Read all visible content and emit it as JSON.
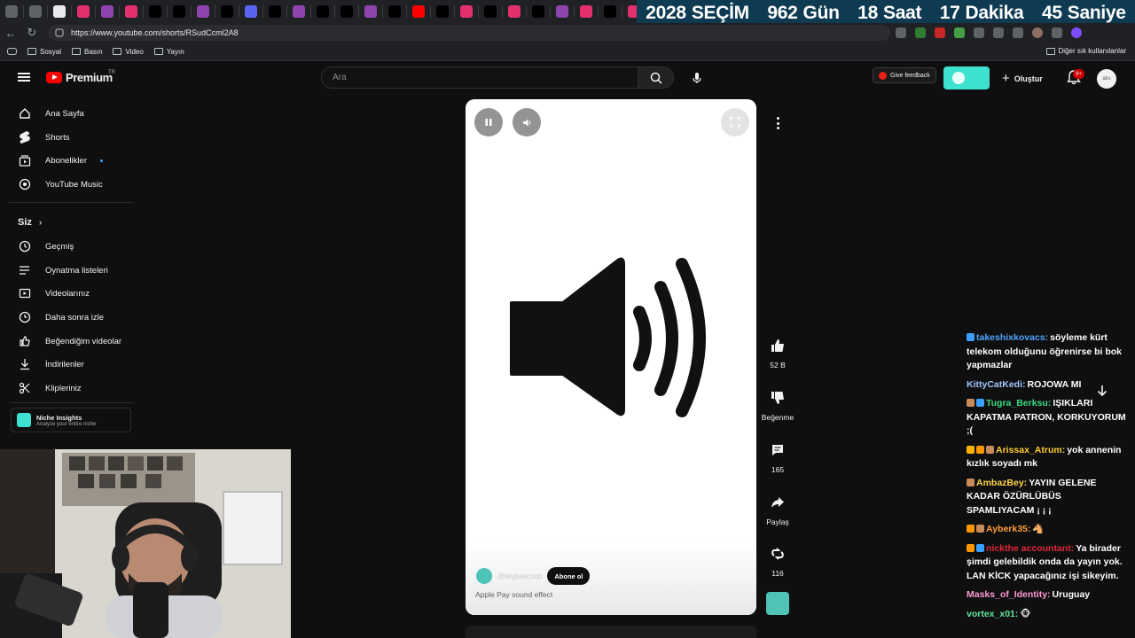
{
  "browser": {
    "url": "https://www.youtube.com/shorts/RSudCcml2A8",
    "bookmarks": [
      "Sosyal",
      "Basın",
      "Video",
      "Yayın"
    ],
    "other_bookmarks": "Diğer sık kullanılanlar"
  },
  "countdown": {
    "year": "2028",
    "label": "SEÇİM",
    "days_value": "962",
    "days_unit": "Gün",
    "hours_value": "18",
    "hours_unit": "Saat",
    "minutes_value": "17",
    "minutes_unit": "Dakika",
    "seconds_value": "45",
    "seconds_unit": "Saniye"
  },
  "header": {
    "logo_text": "Premium",
    "logo_region": "TR",
    "search_placeholder": "Ara",
    "feedback": "Give feedback",
    "create": "Oluştur",
    "notif_count": "9+",
    "avatar_text": "alıs"
  },
  "sidebar": {
    "items": [
      {
        "label": "Ana Sayfa",
        "icon": "home-icon"
      },
      {
        "label": "Shorts",
        "icon": "shorts-icon"
      },
      {
        "label": "Abonelikler",
        "icon": "subscriptions-icon"
      },
      {
        "label": "YouTube Music",
        "icon": "music-icon"
      }
    ],
    "you_heading": "Siz",
    "you_items": [
      {
        "label": "Geçmiş",
        "icon": "history-icon"
      },
      {
        "label": "Oynatma listeleri",
        "icon": "playlist-icon"
      },
      {
        "label": "Videolarınız",
        "icon": "your-videos-icon"
      },
      {
        "label": "Daha sonra izle",
        "icon": "watch-later-icon"
      },
      {
        "label": "Beğendiğim videolar",
        "icon": "liked-icon"
      },
      {
        "label": "İndirilenler",
        "icon": "download-icon"
      },
      {
        "label": "Klipleriniz",
        "icon": "clips-icon"
      }
    ],
    "niche_title": "Niche Insights",
    "niche_sub": "Analyze your entire niche"
  },
  "short": {
    "channel": "@skypescoop",
    "subscribe": "Abone ol",
    "title": "Apple Pay sound effect"
  },
  "actions": {
    "likes": "52 B",
    "dislike": "Beğenme",
    "comments": "165",
    "share": "Paylaş",
    "remix": "116"
  },
  "chat": [
    {
      "user": "takeshixkovacs:",
      "text": "söyleme kürt telekom olduğunu öğrenirse bi bok yapmazlar",
      "color": "#4fa3ff",
      "badges": [
        "#3aa0ff"
      ]
    },
    {
      "user": "KittyCatKedi:",
      "text": "ROJOWA MI",
      "color": "#9ec6ff",
      "badges": []
    },
    {
      "user": "Tugra_Berksu:",
      "text": "IŞIKLARI KAPATMA PATRON, KORKUYORUM ;(",
      "color": "#3ddc84",
      "badges": [
        "#c98a5a",
        "#3aa0ff"
      ]
    },
    {
      "user": "Arissax_Atrum:",
      "text": "yok annenin kızlık soyadı mk",
      "color": "#ffcc33",
      "badges": [
        "#ffb300",
        "#ff9800",
        "#c98a5a"
      ]
    },
    {
      "user": "AmbazBey:",
      "text": "YAYIN GELENE KADAR ÖZÜRLÜBÜS SPAMLIYACAM ¡ ¡ ¡",
      "color": "#ffd54a",
      "badges": [
        "#c98a5a"
      ]
    },
    {
      "user": "Ayberk35:",
      "text": "🐴",
      "color": "#ff9d3c",
      "badges": [
        "#ff9800",
        "#c98a5a"
      ]
    },
    {
      "user": "nickthe accountant:",
      "text": "Ya birader şimdi gelebildik onda da yayın yok. LAN KİCK yapacağınız işi sikeyim.",
      "color": "#e0273c",
      "badges": [
        "#ff9800",
        "#3aa0ff"
      ]
    },
    {
      "user": "Masks_of_Identity:",
      "text": "Uruguay",
      "color": "#ff9ad5",
      "badges": []
    },
    {
      "user": "vortex_x01:",
      "text": "🐵",
      "color": "#5ee89a",
      "badges": []
    }
  ]
}
